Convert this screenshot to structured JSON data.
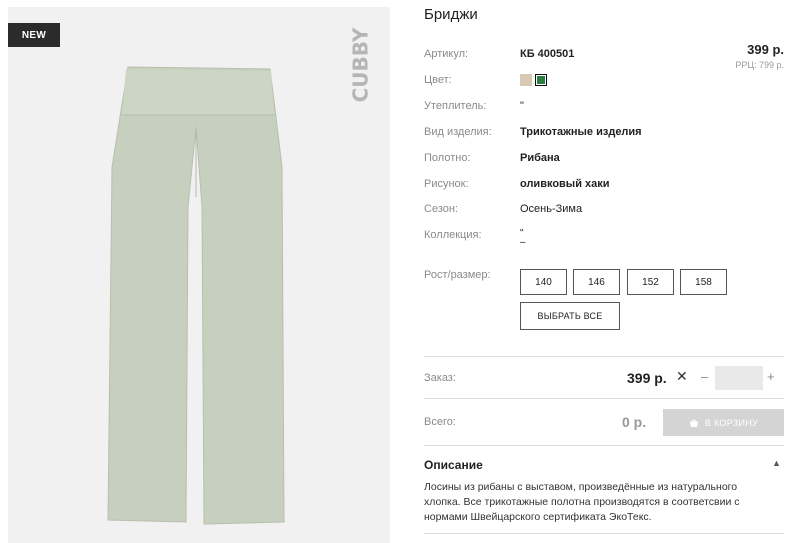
{
  "product": {
    "badge": "NEW",
    "brand": "CUBBY",
    "title": "Бриджи",
    "price": "399 р.",
    "rrp": "РРЦ: 799 р."
  },
  "specs": [
    {
      "label": "Артикул:",
      "value": "КБ 400501"
    },
    {
      "label": "Цвет:",
      "value": ""
    },
    {
      "label": "Утеплитель:",
      "value": "\""
    },
    {
      "label": "Вид изделия:",
      "value": "Трикотажные изделия"
    },
    {
      "label": "Полотно:",
      "value": "Рибана"
    },
    {
      "label": "Рисунок:",
      "value": "оливковый хаки"
    },
    {
      "label": "Сезон:",
      "value": "Осень-Зима"
    },
    {
      "label": "Коллекция:",
      "value": "\"\n–"
    }
  ],
  "colors": {
    "beige": "#d8c9b0",
    "green": "#2e7d45",
    "garment": "#c7cfbe"
  },
  "sizes": {
    "label": "Рост/размер:",
    "options": [
      "140",
      "146",
      "152",
      "158"
    ],
    "select_all": "ВЫБРАТЬ ВСЕ"
  },
  "order": {
    "label": "Заказ:",
    "price": "399 р.",
    "multiply": "✕",
    "minus": "–",
    "plus": "+",
    "quantity": ""
  },
  "total": {
    "label": "Всего:",
    "value": "0 р.",
    "cart_button": "В КОРЗИНУ",
    "cart_icon": "basket-icon"
  },
  "description": {
    "title": "Описание",
    "toggle": "▲",
    "text": "Лосины из рибаны с выставом, произведённые из натурального хлопка. Все трикотажные полотна производятся в соответсвии с нормами Швейцарского сертификата ЭкоТекс."
  }
}
